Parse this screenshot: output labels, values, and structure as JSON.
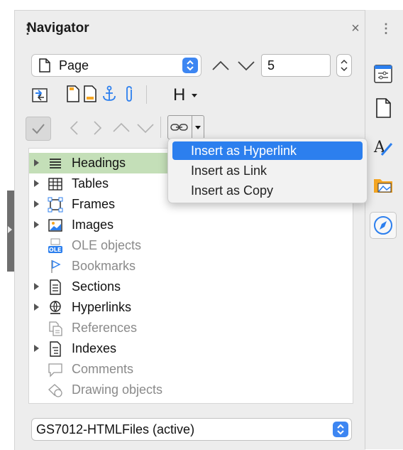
{
  "navigator": {
    "title": "Navigator",
    "close_glyph": "×",
    "type_select_value": "Page",
    "page_number": "5",
    "heading_level_label": "H",
    "tree": [
      {
        "label": "Headings",
        "icon": "headings-icon",
        "expandable": true,
        "active": true,
        "selected": true
      },
      {
        "label": "Tables",
        "icon": "table-icon",
        "expandable": true,
        "active": true,
        "selected": false
      },
      {
        "label": "Frames",
        "icon": "frame-icon",
        "expandable": true,
        "active": true,
        "selected": false
      },
      {
        "label": "Images",
        "icon": "image-icon",
        "expandable": true,
        "active": true,
        "selected": false
      },
      {
        "label": "OLE objects",
        "icon": "ole-icon",
        "expandable": false,
        "active": false,
        "selected": false
      },
      {
        "label": "Bookmarks",
        "icon": "bookmark-icon",
        "expandable": false,
        "active": false,
        "selected": false
      },
      {
        "label": "Sections",
        "icon": "section-icon",
        "expandable": true,
        "active": true,
        "selected": false
      },
      {
        "label": "Hyperlinks",
        "icon": "hyperlink-icon",
        "expandable": true,
        "active": true,
        "selected": false
      },
      {
        "label": "References",
        "icon": "reference-icon",
        "expandable": false,
        "active": false,
        "selected": false
      },
      {
        "label": "Indexes",
        "icon": "index-icon",
        "expandable": true,
        "active": true,
        "selected": false
      },
      {
        "label": "Comments",
        "icon": "comment-icon",
        "expandable": false,
        "active": false,
        "selected": false
      },
      {
        "label": "Drawing objects",
        "icon": "drawing-icon",
        "expandable": false,
        "active": false,
        "selected": false
      }
    ],
    "document_select_value": "GS7012-HTMLFiles (active)",
    "drag_mode_menu": [
      {
        "label": "Insert as Hyperlink",
        "highlighted": true
      },
      {
        "label": "Insert as Link",
        "highlighted": false
      },
      {
        "label": "Insert as Copy",
        "highlighted": false
      }
    ]
  },
  "colors": {
    "selection_green": "#c4dfb8",
    "menu_highlight": "#2c7fee",
    "select_accent": "#3d86f2"
  }
}
